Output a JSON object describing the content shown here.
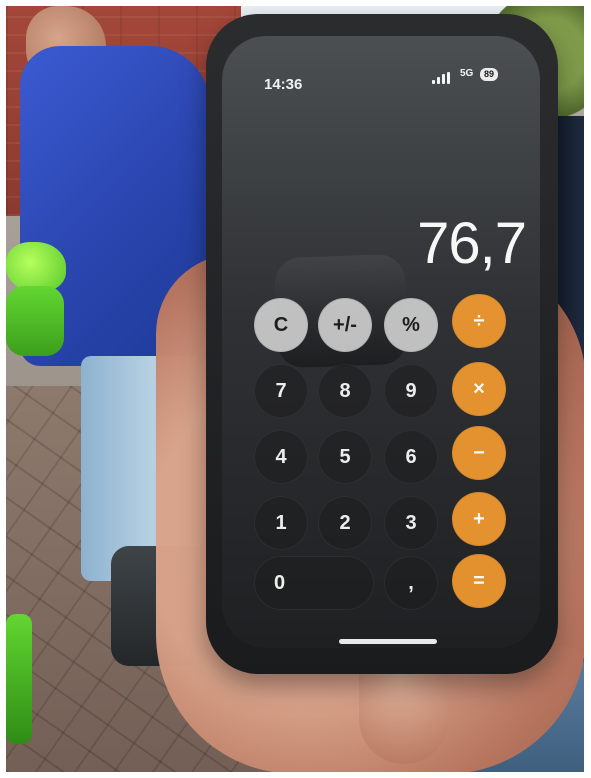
{
  "status_bar": {
    "time": "14:36",
    "network": "5G",
    "battery": "89"
  },
  "calculator": {
    "display": "76,7",
    "rows": [
      [
        "C",
        "+/-",
        "%",
        "÷"
      ],
      [
        "7",
        "8",
        "9",
        "×"
      ],
      [
        "4",
        "5",
        "6",
        "−"
      ],
      [
        "1",
        "2",
        "3",
        "+"
      ],
      [
        "0",
        ",",
        "="
      ]
    ]
  },
  "colors": {
    "operator_orange": "#f49b30",
    "function_gray": "#cdcdcd",
    "digit_dark": "#1e1e1e"
  }
}
